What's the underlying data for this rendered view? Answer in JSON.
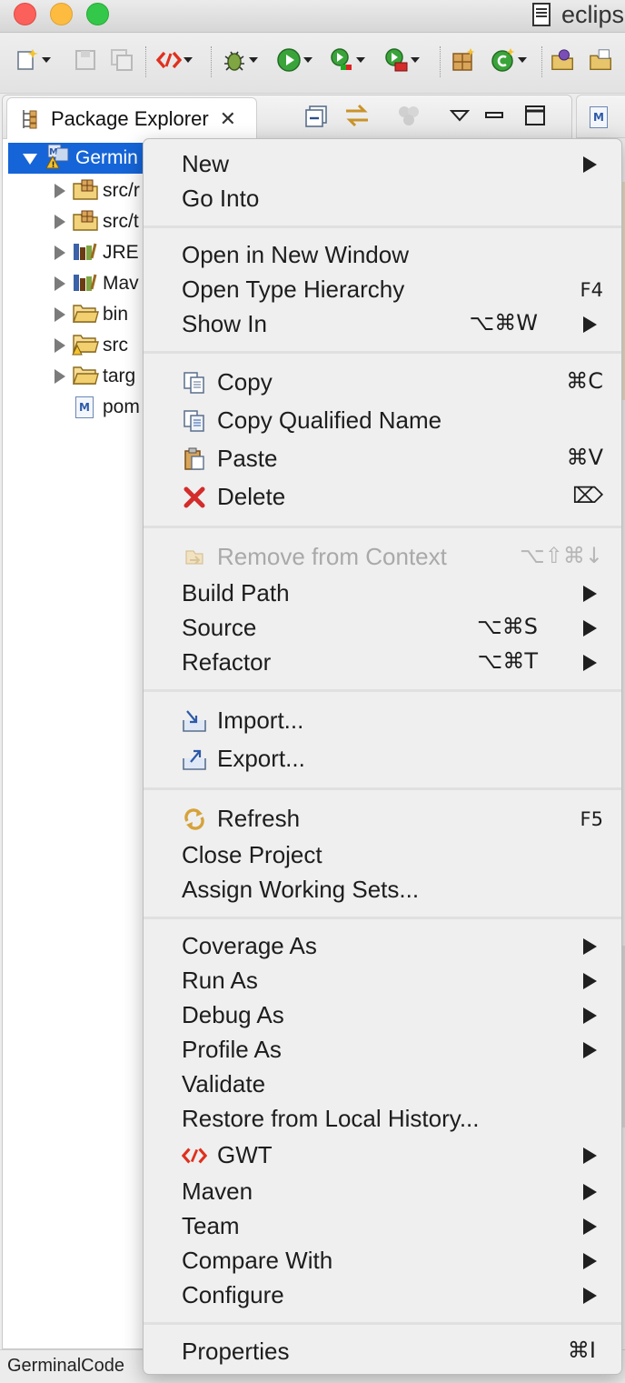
{
  "window": {
    "title": "eclips",
    "controls": [
      "close",
      "minimize",
      "zoom"
    ]
  },
  "toolbar": {
    "buttons": [
      {
        "name": "new-wizard-icon",
        "dropdown": true
      },
      {
        "name": "save-icon",
        "dropdown": false
      },
      {
        "name": "save-all-icon",
        "dropdown": false
      },
      {
        "name": "gwt-icon",
        "dropdown": true
      },
      {
        "name": "debug-icon",
        "dropdown": true
      },
      {
        "name": "run-icon",
        "dropdown": true
      },
      {
        "name": "coverage-icon",
        "dropdown": true
      },
      {
        "name": "external-tools-icon",
        "dropdown": true
      },
      {
        "name": "new-java-package-icon",
        "dropdown": false
      },
      {
        "name": "new-java-class-icon",
        "dropdown": true
      },
      {
        "name": "open-type-icon",
        "dropdown": false
      },
      {
        "name": "open-task-icon",
        "dropdown": false
      }
    ]
  },
  "package_explorer": {
    "tab_label": "Package Explorer",
    "tree": [
      {
        "label": "Germin",
        "icon": "maven-project-icon",
        "expanded": true,
        "selected": true
      },
      {
        "label": "src/r",
        "icon": "source-folder-icon",
        "expanded": false
      },
      {
        "label": "src/t",
        "icon": "source-folder-icon",
        "expanded": false
      },
      {
        "label": "JRE",
        "icon": "library-icon",
        "expanded": false
      },
      {
        "label": "Mav",
        "icon": "library-icon",
        "expanded": false
      },
      {
        "label": "bin",
        "icon": "folder-icon",
        "expanded": false
      },
      {
        "label": "src",
        "icon": "folder-warning-icon",
        "expanded": false
      },
      {
        "label": "targ",
        "icon": "folder-icon",
        "expanded": false
      },
      {
        "label": "pom",
        "icon": "pom-file-icon",
        "expanded": null
      }
    ]
  },
  "status_bar": {
    "text": "GerminalCode"
  },
  "context_menu": {
    "items": [
      {
        "label": "New",
        "shortcut": "",
        "submenu": true,
        "icon": null,
        "enabled": true
      },
      {
        "label": "Go Into",
        "shortcut": "",
        "submenu": false,
        "icon": null,
        "enabled": true
      },
      {
        "label": "Open in New Window",
        "shortcut": "",
        "submenu": false,
        "icon": null,
        "enabled": true
      },
      {
        "label": "Open Type Hierarchy",
        "shortcut": "F4",
        "submenu": false,
        "icon": null,
        "enabled": true
      },
      {
        "label": "Show In",
        "shortcut": "⌥⌘W",
        "submenu": true,
        "icon": null,
        "enabled": true
      },
      {
        "label": "Copy",
        "shortcut": "⌘C",
        "submenu": false,
        "icon": "copy-icon",
        "enabled": true
      },
      {
        "label": "Copy Qualified Name",
        "shortcut": "",
        "submenu": false,
        "icon": "copy-qualified-name-icon",
        "enabled": true
      },
      {
        "label": "Paste",
        "shortcut": "⌘V",
        "submenu": false,
        "icon": "paste-icon",
        "enabled": true
      },
      {
        "label": "Delete",
        "shortcut": "⌦",
        "submenu": false,
        "icon": "delete-icon",
        "enabled": true
      },
      {
        "label": "Remove from Context",
        "shortcut": "⌥⇧⌘↓",
        "submenu": false,
        "icon": "remove-context-icon",
        "enabled": false
      },
      {
        "label": "Build Path",
        "shortcut": "",
        "submenu": true,
        "icon": null,
        "enabled": true
      },
      {
        "label": "Source",
        "shortcut": "⌥⌘S",
        "submenu": true,
        "icon": null,
        "enabled": true
      },
      {
        "label": "Refactor",
        "shortcut": "⌥⌘T",
        "submenu": true,
        "icon": null,
        "enabled": true
      },
      {
        "label": "Import...",
        "shortcut": "",
        "submenu": false,
        "icon": "import-icon",
        "enabled": true
      },
      {
        "label": "Export...",
        "shortcut": "",
        "submenu": false,
        "icon": "export-icon",
        "enabled": true
      },
      {
        "label": "Refresh",
        "shortcut": "F5",
        "submenu": false,
        "icon": "refresh-icon",
        "enabled": true
      },
      {
        "label": "Close Project",
        "shortcut": "",
        "submenu": false,
        "icon": null,
        "enabled": true
      },
      {
        "label": "Assign Working Sets...",
        "shortcut": "",
        "submenu": false,
        "icon": null,
        "enabled": true
      },
      {
        "label": "Coverage As",
        "shortcut": "",
        "submenu": true,
        "icon": null,
        "enabled": true
      },
      {
        "label": "Run As",
        "shortcut": "",
        "submenu": true,
        "icon": null,
        "enabled": true
      },
      {
        "label": "Debug As",
        "shortcut": "",
        "submenu": true,
        "icon": null,
        "enabled": true
      },
      {
        "label": "Profile As",
        "shortcut": "",
        "submenu": true,
        "icon": null,
        "enabled": true
      },
      {
        "label": "Validate",
        "shortcut": "",
        "submenu": false,
        "icon": null,
        "enabled": true
      },
      {
        "label": "Restore from Local History...",
        "shortcut": "",
        "submenu": false,
        "icon": null,
        "enabled": true
      },
      {
        "label": "GWT",
        "shortcut": "",
        "submenu": true,
        "icon": "gwt-icon",
        "enabled": true
      },
      {
        "label": "Maven",
        "shortcut": "",
        "submenu": true,
        "icon": null,
        "enabled": true
      },
      {
        "label": "Team",
        "shortcut": "",
        "submenu": true,
        "icon": null,
        "enabled": true
      },
      {
        "label": "Compare With",
        "shortcut": "",
        "submenu": true,
        "icon": null,
        "enabled": true
      },
      {
        "label": "Configure",
        "shortcut": "",
        "submenu": true,
        "icon": null,
        "enabled": true
      },
      {
        "label": "Properties",
        "shortcut": "⌘I",
        "submenu": false,
        "icon": null,
        "enabled": true
      }
    ]
  },
  "colors": {
    "selection": "#1565d8",
    "menu_background": "#efefef",
    "disabled_text": "#a9a9a9"
  }
}
